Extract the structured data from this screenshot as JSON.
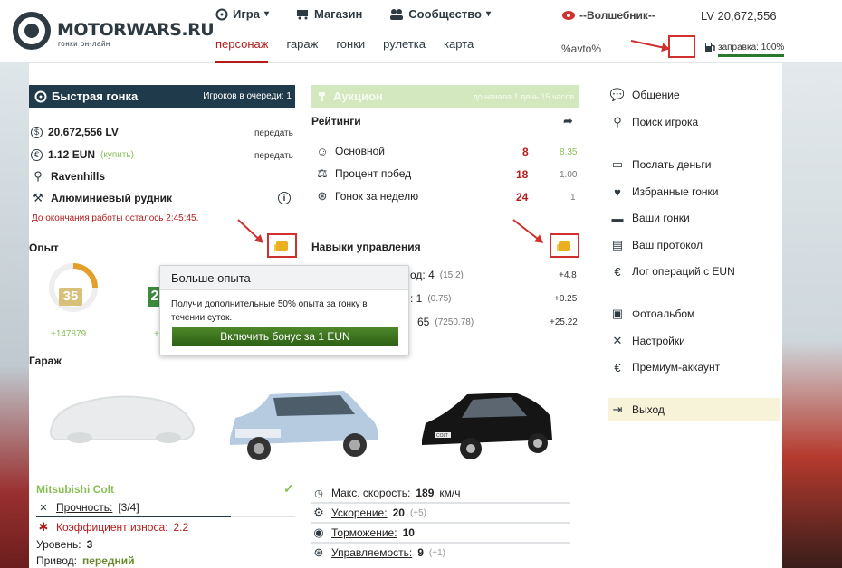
{
  "brand": {
    "name": "MOTORWARS.RU",
    "tagline": "гонки он-лайн"
  },
  "nav": {
    "items": [
      {
        "label": "Игра"
      },
      {
        "label": "Магазин"
      },
      {
        "label": "Сообщество"
      }
    ]
  },
  "subnav": {
    "items": [
      "персонаж",
      "гараж",
      "гонки",
      "рулетка",
      "карта"
    ],
    "active": "персонаж"
  },
  "user": {
    "name": "--Волшебник--",
    "money": "LV 20,672,556",
    "avto": "%avto%",
    "fuel": "заправка: 100%"
  },
  "quick_race": {
    "title": "Быстрая гонка",
    "queue": "Игроков в очереди: 1"
  },
  "wallet": {
    "lv": "20,672,556 LV",
    "lv_action": "передать",
    "eun": "1.12 EUN",
    "eun_buy": "(купить)",
    "eun_action": "передать",
    "city": "Ravenhills",
    "work": "Алюминиевый рудник",
    "work_timer": "До окончания работы осталось 2:45:45."
  },
  "experience": {
    "title": "Опыт",
    "level": "35",
    "gain": "+147879",
    "level2_partial": "2",
    "gain2_partial": "+"
  },
  "popup": {
    "title": "Больше опыта",
    "text": "Получи дополнительные 50% опыта за гонку в течении суток.",
    "button": "Включить бонус за 1 EUN"
  },
  "auction": {
    "title": "Аукцион",
    "timer": "до начала 1 день 15 часов"
  },
  "ratings": {
    "title": "Рейтинги",
    "rows": [
      {
        "label": "Основной",
        "value": "8",
        "extra": "8.35"
      },
      {
        "label": "Процент побед",
        "value": "18",
        "extra": "1.00"
      },
      {
        "label": "Гонок за неделю",
        "value": "24",
        "extra": "1"
      }
    ]
  },
  "skills": {
    "title": "Навыки управления",
    "rows": [
      {
        "text": "од: 4",
        "sub": "(15.2)",
        "delta": "+4.8"
      },
      {
        "text": ": 1",
        "sub": "(0.75)",
        "delta": "+0.25"
      },
      {
        "text": "65",
        "sub": "(7250.78)",
        "delta": "+25.22"
      }
    ]
  },
  "garage": {
    "title": "Гараж",
    "car": "Mitsubishi Colt",
    "durability_label": "Прочность:",
    "durability": "[3/4]",
    "durability_fraction": 0.75,
    "wear_label": "Коэффициент износа:",
    "wear": "2.2",
    "level_label": "Уровень:",
    "level": "3",
    "drive_label": "Привод:",
    "drive": "передний",
    "max_speed_label": "Макс. скорость:",
    "max_speed": "189",
    "speed_unit": "км/ч",
    "accel_label": "Ускорение:",
    "accel": "20",
    "accel_bonus": "(+5)",
    "brake_label": "Торможение:",
    "brake": "10",
    "handling_label": "Управляемость:",
    "handling": "9",
    "handling_bonus": "(+1)",
    "plate": "COLT"
  },
  "menu": {
    "items": [
      {
        "label": "Общение",
        "icon": "chat-icon"
      },
      {
        "label": "Поиск игрока",
        "icon": "search-icon"
      },
      {
        "label": "Послать деньги",
        "icon": "money-icon"
      },
      {
        "label": "Избранные гонки",
        "icon": "heart-icon"
      },
      {
        "label": "Ваши гонки",
        "icon": "car-icon"
      },
      {
        "label": "Ваш протокол",
        "icon": "document-icon"
      },
      {
        "label": "Лог операций с EUN",
        "icon": "euro-icon"
      },
      {
        "label": "Фотоальбом",
        "icon": "photo-icon"
      },
      {
        "label": "Настройки",
        "icon": "tools-icon"
      },
      {
        "label": "Премиум-аккаунт",
        "icon": "euro-icon"
      },
      {
        "label": "Выход",
        "icon": "exit-icon"
      }
    ]
  },
  "colors": {
    "accent": "#b41c1c",
    "dark": "#1f3a4a",
    "green": "#2d5f15",
    "highlight": "#d0302e"
  }
}
